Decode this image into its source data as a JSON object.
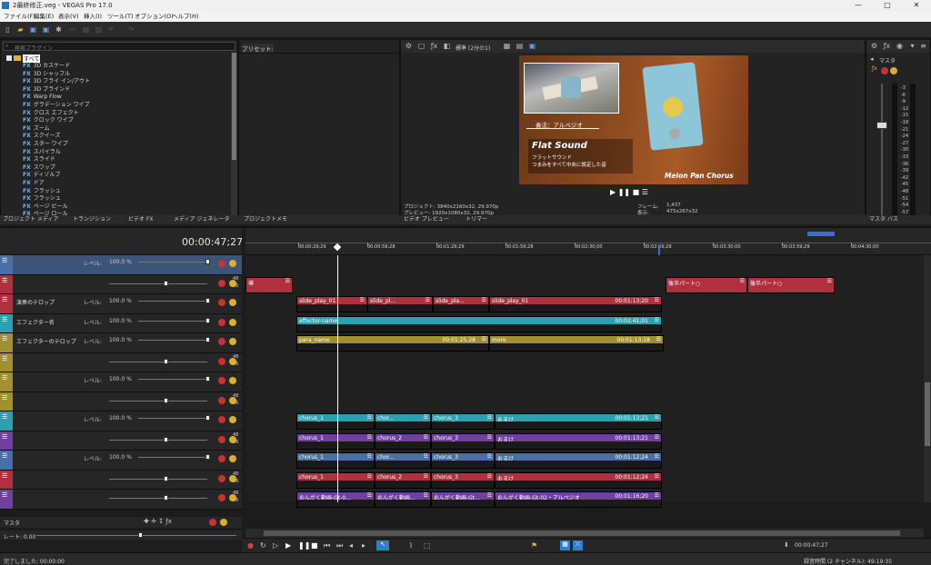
{
  "window": {
    "title": "2最終修正.veg - VEGAS Pro 17.0",
    "controls": [
      "—",
      "□",
      "✕"
    ]
  },
  "menu": [
    "ファイル(F)",
    "編集(E)",
    "表示(V)",
    "挿入(I)",
    "ツール(T)",
    "オプション(O)",
    "ヘルプ(H)"
  ],
  "explorer": {
    "search_placeholder": "検索プラグイン",
    "root": "すべて",
    "fx_prefix": "FX",
    "items": [
      "3D カスケード",
      "3D シャッフル",
      "3D フライ イン/アウト",
      "3D ブラインド",
      "Warp Flow",
      "グラデーション ワイプ",
      "クロス エフェクト",
      "クロック ワイプ",
      "ズーム",
      "スクイーズ",
      "スター ワイプ",
      "スパイラル",
      "スライド",
      "スワップ",
      "ディゾルブ",
      "ドア",
      "フラッシュ",
      "フラッシュ",
      "ページ ピール",
      "ページ ロール"
    ],
    "presets_label": "プリセット:",
    "tabs": [
      "プロジェクト メディア",
      "トランジション",
      "ビデオ FX",
      "メディア ジェネレータ",
      "プロジェクトメモ"
    ]
  },
  "preview": {
    "toolbar_label": "標準 (2分の1)",
    "overlay_caption": "奏法：アルペジオ",
    "title_big": "Flat Sound",
    "subtitle1": "フラットサウンド",
    "subtitle2": "つまみをすべて中央に設定した音",
    "product": "Melon Pan Chorus",
    "info": {
      "project": "プロジェクト: 3840x2160x32, 29.970p",
      "preview": "プレビュー: 1920x1080x32, 29.970p",
      "frame_label": "フレーム:",
      "frame_value": "1,437",
      "display_label": "表示:",
      "display_value": "475x267x32"
    },
    "tabs": [
      "ビデオ プレビュー",
      "トリマー"
    ]
  },
  "master": {
    "label": "マスタ",
    "tab": "マスタ バス",
    "scale": [
      "3",
      "6",
      "9",
      "12",
      "15",
      "18",
      "21",
      "24",
      "27",
      "30",
      "33",
      "36",
      "39",
      "42",
      "45",
      "48",
      "51",
      "54",
      "57"
    ]
  },
  "timeline": {
    "timecode": "00:00:47;27",
    "ruler": [
      "00:00:29;29",
      "00:00:59;28",
      "00:01:29;29",
      "00:01:59;28",
      "00:02:30;00",
      "00:02:59;29",
      "00:03:30;00",
      "00:03:59;29",
      "00:04:30;00"
    ],
    "level_label": "レベル:",
    "level_value": "100.0 %",
    "meter_nums": [
      "48",
      "96"
    ],
    "tracks": [
      {
        "name": "",
        "color": "#4a6fa8",
        "type": "video"
      },
      {
        "name": "",
        "color": "#b03040",
        "type": "audio"
      },
      {
        "name": "演奏のテロップ",
        "color": "#b03040",
        "type": "video"
      },
      {
        "name": "エフェクター名",
        "color": "#2aa0b0",
        "type": "video"
      },
      {
        "name": "エフェクターのテロップ",
        "color": "#a09030",
        "type": "video"
      },
      {
        "name": "",
        "color": "#a09030",
        "type": "audio"
      },
      {
        "name": "",
        "color": "#a09030",
        "type": "video"
      },
      {
        "name": "",
        "color": "#a09030",
        "type": "audio"
      },
      {
        "name": "",
        "color": "#2aa0b0",
        "type": "video"
      },
      {
        "name": "",
        "color": "#7040a0",
        "type": "audio"
      },
      {
        "name": "",
        "color": "#4a6fa8",
        "type": "video"
      },
      {
        "name": "",
        "color": "#b03040",
        "type": "audio"
      },
      {
        "name": "",
        "color": "#7040a0",
        "type": "audio"
      }
    ],
    "clips": {
      "row1": [
        {
          "label": "導",
          "c": "#b03040"
        },
        {
          "label": "後半パート○",
          "c": "#b03040"
        },
        {
          "label": "後半パート○",
          "c": "#b03040"
        }
      ],
      "row2": [
        {
          "label": "slide_play_01"
        },
        {
          "label": "slide_pl..."
        },
        {
          "label": "slide_pla..."
        },
        {
          "label": "slide_play_01",
          "time": "00:01:13;20"
        }
      ],
      "row3": [
        {
          "label": "effector-name",
          "time": "00:02:41;01"
        }
      ],
      "row4": [
        {
          "label": "para_name",
          "time": "00:01:25;28"
        },
        {
          "label": "more",
          "time": "00:01:13;18"
        }
      ],
      "row5": [
        {
          "label": "chorus_1"
        },
        {
          "label": "chor..."
        },
        {
          "label": "chorus_3"
        },
        {
          "label": "おまけ",
          "time": "00:01:13;21"
        }
      ],
      "row6": [
        {
          "label": "chorus_1"
        },
        {
          "label": "chorus_2"
        },
        {
          "label": "chorus_3"
        },
        {
          "label": "おまけ",
          "time": "00:01:13;21"
        }
      ],
      "row7": [
        {
          "label": "chorus_1"
        },
        {
          "label": "chor..."
        },
        {
          "label": "chorus_3"
        },
        {
          "label": "おまけ",
          "time": "00:01:12;24"
        }
      ],
      "row8": [
        {
          "label": "chorus_1"
        },
        {
          "label": "chorus_2"
        },
        {
          "label": "chorus_3"
        },
        {
          "label": "おまけ",
          "time": "00:01:12;24"
        }
      ],
      "row9": [
        {
          "label": "おんがく動画-Gt-0..."
        },
        {
          "label": "おんがく動画..."
        },
        {
          "label": "おんがく動画-Gt..."
        },
        {
          "label": "おんがく動画-Gt-02・アルペジオ",
          "time": "00:01:16;20"
        }
      ]
    },
    "master_label": "マスタ",
    "rate_label": "レート: 0.00",
    "transport_time": "00:00:47;27"
  },
  "status": {
    "left": "完了しました: 00:00:00",
    "right": "録音時間 (2 チャンネル): 49:19:35"
  },
  "colors": {
    "accent": "#2f7fd0",
    "bg": "#1e1e1e"
  }
}
